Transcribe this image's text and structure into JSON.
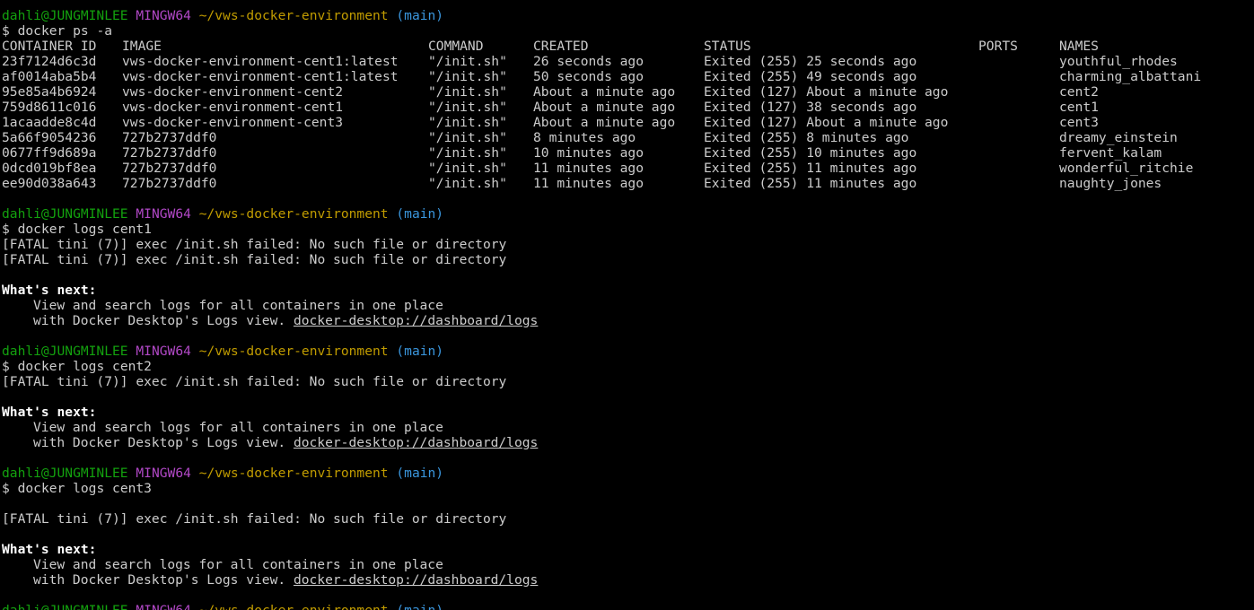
{
  "prompt": {
    "user": "dahli@JUNGMINLEE",
    "system": "MINGW64",
    "path": "~/vws-docker-environment",
    "branch": "(main)",
    "symbol": "$"
  },
  "ps": {
    "command": "docker ps -a",
    "headers": [
      "CONTAINER ID",
      "IMAGE",
      "COMMAND",
      "CREATED",
      "STATUS",
      "PORTS",
      "NAMES"
    ],
    "rows": [
      [
        "23f7124d6c3d",
        "vws-docker-environment-cent1:latest",
        "\"/init.sh\"",
        "26 seconds ago",
        "Exited (255) 25 seconds ago",
        "",
        "youthful_rhodes"
      ],
      [
        "af0014aba5b4",
        "vws-docker-environment-cent1:latest",
        "\"/init.sh\"",
        "50 seconds ago",
        "Exited (255) 49 seconds ago",
        "",
        "charming_albattani"
      ],
      [
        "95e85a4b6924",
        "vws-docker-environment-cent2",
        "\"/init.sh\"",
        "About a minute ago",
        "Exited (127) About a minute ago",
        "",
        "cent2"
      ],
      [
        "759d8611c016",
        "vws-docker-environment-cent1",
        "\"/init.sh\"",
        "About a minute ago",
        "Exited (127) 38 seconds ago",
        "",
        "cent1"
      ],
      [
        "1acaadde8c4d",
        "vws-docker-environment-cent3",
        "\"/init.sh\"",
        "About a minute ago",
        "Exited (127) About a minute ago",
        "",
        "cent3"
      ],
      [
        "5a66f9054236",
        "727b2737ddf0",
        "\"/init.sh\"",
        "8 minutes ago",
        "Exited (255) 8 minutes ago",
        "",
        "dreamy_einstein"
      ],
      [
        "0677ff9d689a",
        "727b2737ddf0",
        "\"/init.sh\"",
        "10 minutes ago",
        "Exited (255) 10 minutes ago",
        "",
        "fervent_kalam"
      ],
      [
        "0dcd019bf8ea",
        "727b2737ddf0",
        "\"/init.sh\"",
        "11 minutes ago",
        "Exited (255) 11 minutes ago",
        "",
        "wonderful_ritchie"
      ],
      [
        "ee90d038a643",
        "727b2737ddf0",
        "\"/init.sh\"",
        "11 minutes ago",
        "Exited (255) 11 minutes ago",
        "",
        "naughty_jones"
      ]
    ]
  },
  "logs": [
    {
      "command": "docker logs cent1",
      "output": [
        "[FATAL tini (7)] exec /init.sh failed: No such file or directory",
        "[FATAL tini (7)] exec /init.sh failed: No such file or directory"
      ]
    },
    {
      "command": "docker logs cent2",
      "output": [
        "[FATAL tini (7)] exec /init.sh failed: No such file or directory"
      ]
    },
    {
      "command": "docker logs cent3",
      "output": [
        "",
        "[FATAL tini (7)] exec /init.sh failed: No such file or directory"
      ]
    }
  ],
  "whats_next": {
    "title": "What's next:",
    "line1": "View and search logs for all containers in one place",
    "line2_prefix": "with Docker Desktop's Logs view. ",
    "link": "docker-desktop://dashboard/logs"
  }
}
